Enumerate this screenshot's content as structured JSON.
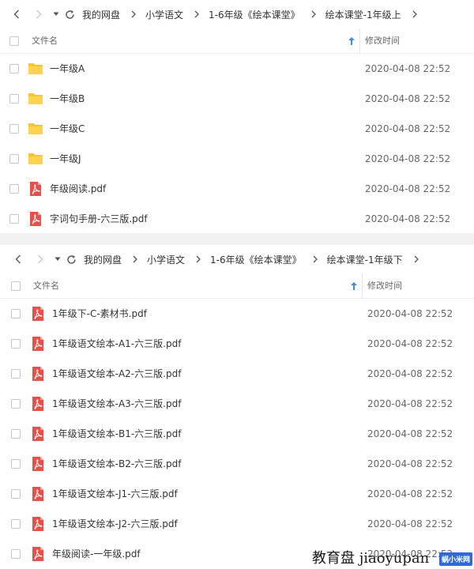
{
  "panels": [
    {
      "breadcrumbs": [
        "我的网盘",
        "小学语文",
        "1-6年级《绘本课堂》",
        "绘本课堂-1年级上"
      ],
      "header": {
        "name_label": "文件名",
        "time_label": "修改时间"
      },
      "files": [
        {
          "type": "folder",
          "name": "一年级A",
          "time": "2020-04-08 22:52"
        },
        {
          "type": "folder",
          "name": "一年级B",
          "time": "2020-04-08 22:52"
        },
        {
          "type": "folder",
          "name": "一年级C",
          "time": "2020-04-08 22:52"
        },
        {
          "type": "folder",
          "name": "一年级J",
          "time": "2020-04-08 22:52"
        },
        {
          "type": "pdf",
          "name": "年级阅读.pdf",
          "time": "2020-04-08 22:52"
        },
        {
          "type": "pdf",
          "name": "字词句手册-六三版.pdf",
          "time": "2020-04-08 22:52"
        }
      ]
    },
    {
      "breadcrumbs": [
        "我的网盘",
        "小学语文",
        "1-6年级《绘本课堂》",
        "绘本课堂-1年级下"
      ],
      "header": {
        "name_label": "文件名",
        "time_label": "修改时间"
      },
      "files": [
        {
          "type": "pdf",
          "name": "1年级下-C-素材书.pdf",
          "time": "2020-04-08 22:52"
        },
        {
          "type": "pdf",
          "name": "1年级语文绘本-A1-六三版.pdf",
          "time": "2020-04-08 22:52"
        },
        {
          "type": "pdf",
          "name": "1年级语文绘本-A2-六三版.pdf",
          "time": "2020-04-08 22:52"
        },
        {
          "type": "pdf",
          "name": "1年级语文绘本-A3-六三版.pdf",
          "time": "2020-04-08 22:52"
        },
        {
          "type": "pdf",
          "name": "1年级语文绘本-B1-六三版.pdf",
          "time": "2020-04-08 22:52"
        },
        {
          "type": "pdf",
          "name": "1年级语文绘本-B2-六三版.pdf",
          "time": "2020-04-08 22:52"
        },
        {
          "type": "pdf",
          "name": "1年级语文绘本-J1-六三版.pdf",
          "time": "2020-04-08 22:52"
        },
        {
          "type": "pdf",
          "name": "1年级语文绘本-J2-六三版.pdf",
          "time": "2020-04-08 22:52"
        },
        {
          "type": "pdf",
          "name": "年级阅读-一年级.pdf",
          "time": "2020-04-08 22:52"
        }
      ]
    }
  ],
  "icons": {
    "folder": "folder-icon",
    "pdf": "pdf-file-icon",
    "nav": [
      "back-arrow-icon",
      "forward-arrow-icon",
      "history-dropdown-icon",
      "refresh-icon"
    ]
  },
  "colors": {
    "folder": "#f8c532",
    "pdf": "#e8504a",
    "accent": "#3b8ee8"
  },
  "watermark": {
    "text": "教育盘 jiaoyupan",
    "logo": "蜗小米网"
  }
}
